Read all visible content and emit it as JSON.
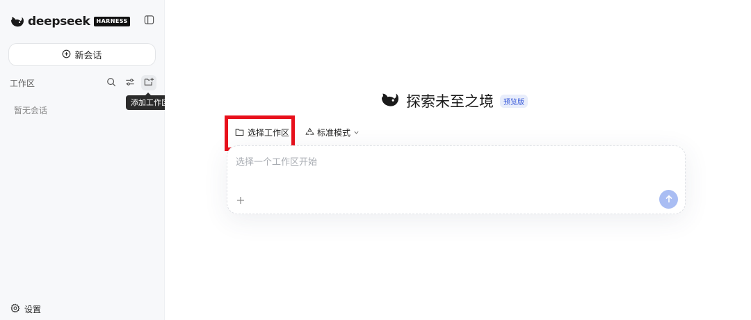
{
  "sidebar": {
    "brand": {
      "word": "deepseek",
      "badge": "HARNESS"
    },
    "new_chat_label": "新会话",
    "workspace_label": "工作区",
    "tooltip": "添加工作区",
    "empty_note": "暂无会话",
    "settings_label": "设置"
  },
  "main": {
    "title": "探索未至之境",
    "badge": "预览版",
    "workspace_select_label": "选择工作区",
    "mode_label": "标准模式",
    "input_placeholder": "选择一个工作区开始"
  },
  "colors": {
    "accent": "#3a5bd9",
    "send_button": "#a9bdf3",
    "highlight": "#e8101b",
    "brand": "#1a1a1a"
  },
  "icons": {
    "brand": "whale-icon",
    "collapse": "sidebar-toggle-icon",
    "new_chat": "plus-circle-icon",
    "search": "search-icon",
    "filter": "sliders-icon",
    "add_folder": "folder-plus-icon",
    "settings": "gear-icon",
    "folder": "folder-icon",
    "mode": "recycle-icon",
    "chevron": "chevron-down-icon",
    "attach": "plus-icon",
    "send": "arrow-up-icon"
  }
}
